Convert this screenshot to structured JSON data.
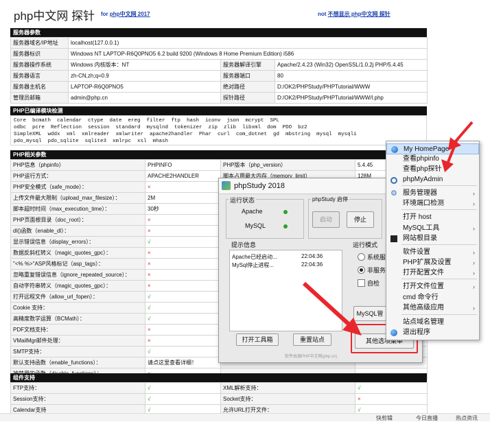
{
  "header": {
    "title": "php中文网 探针",
    "for_prefix": "for",
    "for_link": "php中文网 2017",
    "not_prefix": "not",
    "not_link": "不想显示 php中文网 探针"
  },
  "server": {
    "section_title": "服务器参数",
    "rows": [
      {
        "l1": "服务器域名/IP地址",
        "v1": "localhost(127.0.0.1)",
        "l2": "",
        "v2": ""
      },
      {
        "l1": "服务器标识",
        "v1": "Windows NT LAPTOP-R6Q0PNO5 6.2 build 9200 (Windows 8 Home Premium Edition) i586",
        "l2": "",
        "v2": ""
      },
      {
        "l1": "服务器操作系统",
        "v1": "Windows  内核版本：NT",
        "l2": "服务器解译引擎",
        "v2": "Apache/2.4.23 (Win32) OpenSSL/1.0.2j PHP/5.4.45"
      },
      {
        "l1": "服务器语言",
        "v1": "zh-CN,zh;q=0.9",
        "l2": "服务器端口",
        "v2": "80"
      },
      {
        "l1": "服务器主机名",
        "v1": "LAPTOP-R6Q0PNO5",
        "l2": "绝对路径",
        "v2": "D:/OK2/PHPStudy/PHPTutorial/WWW"
      },
      {
        "l1": "管理员邮箱",
        "v1": "admin@php.cn",
        "l2": "探针路径",
        "v2": "D:/OK2/PHPStudy/PHPTutorial/WWW/l.php"
      }
    ]
  },
  "modules": {
    "section_title": "PHP已编译模块检测",
    "lines": [
      "Core  bcmath  calendar  ctype  date  ereg  filter  ftp  hash  iconv  json  mcrypt  SPL",
      "odbc  pcre  Reflection  session  standard  mysqlnd  tokenizer  zip  zlib  libxml  dom  PDO  bz2",
      "SimpleXML  wddx  xml  xmlreader  xmlwriter  apache2handler  Phar  curl  com_dotnet  gd  mbstring  mysql  mysqli",
      "pdo_mysql  pdo_sqlite  sqlite3  xmlrpc  xsl  mhash"
    ]
  },
  "php": {
    "section_title": "PHP相关参数",
    "rows": [
      {
        "l1": "PHP信息（phpinfo）",
        "v1": "PHPINFO",
        "l2": "PHP版本（php_version）",
        "v2": "5.4.45"
      },
      {
        "l1": "PHP运行方式：",
        "v1": "APACHE2HANDLER",
        "l2": "脚本占用最大内存（memory_limit）",
        "v2": "128M"
      },
      {
        "l1": "PHP安全模式（safe_mode）：",
        "v1": "×",
        "l2": "",
        "v2": ""
      },
      {
        "l1": "上传文件最大限制（upload_max_filesize）：",
        "v1": "2M",
        "l2": "",
        "v2": ""
      },
      {
        "l1": "脚本超时时间（max_execution_time）：",
        "v1": "30秒",
        "l2": "",
        "v2": ""
      },
      {
        "l1": "PHP页面根目录（doc_root）：",
        "v1": "×",
        "l2": "",
        "v2": ""
      },
      {
        "l1": "dl()函数（enable_dl）：",
        "v1": "×",
        "l2": "",
        "v2": ""
      },
      {
        "l1": "显示错误信息（display_errors）：",
        "v1": "√",
        "l2": "",
        "v2": ""
      },
      {
        "l1": "数据反斜杠转义（magic_quotes_gpc）：",
        "v1": "×",
        "l2": "",
        "v2": ""
      },
      {
        "l1": "\"<% %>\"ASP风格标记（asp_tags）：",
        "v1": "×",
        "l2": "",
        "v2": ""
      },
      {
        "l1": "忽略重复错误信息（ignore_repeated_source）：",
        "v1": "×",
        "l2": "",
        "v2": ""
      },
      {
        "l1": "自动字符串转义（magic_quotes_gpc）：",
        "v1": "×",
        "l2": "",
        "v2": ""
      },
      {
        "l1": "打开远程文件（allow_url_fopen）：",
        "v1": "√",
        "l2": "",
        "v2": ""
      },
      {
        "l1": "Cookie 支持：",
        "v1": "√",
        "l2": "",
        "v2": ""
      },
      {
        "l1": "高精度数学运算（BCMath）：",
        "v1": "√",
        "l2": "",
        "v2": ""
      },
      {
        "l1": "PDF文档支持：",
        "v1": "×",
        "l2": "",
        "v2": ""
      },
      {
        "l1": "VMailMgr邮件处理：",
        "v1": "×",
        "l2": "",
        "v2": ""
      },
      {
        "l1": "SMTP支持：",
        "v1": "√",
        "l2": "",
        "v2": ""
      },
      {
        "l1": "默认支持函数（enable_functions）：",
        "v1": "请点这里查看详细！",
        "l2": "",
        "v2": ""
      },
      {
        "l1": "被禁用的函数（disable_functions）：",
        "v1": "×",
        "l2": "",
        "v2": ""
      }
    ]
  },
  "components": {
    "section_title": "组件支持",
    "rows": [
      {
        "l1": "FTP支持：",
        "v1": "√",
        "l2": "XML解析支持：",
        "v2": "√"
      },
      {
        "l1": "Session支持：",
        "v1": "√",
        "l2": "Socket支持：",
        "v2": "×"
      },
      {
        "l1": "Calendar支持",
        "v1": "√",
        "l2": "允许URL打开文件：",
        "v2": "√"
      }
    ]
  },
  "phpstudy": {
    "title": "phpStudy 2018",
    "run_status": "运行状态",
    "apache": "Apache",
    "mysql": "MySQL",
    "start_stop": "phpStudy  启停",
    "start_btn": "启动",
    "stop_btn": "停止",
    "info_label": "提示信息",
    "log": [
      {
        "msg": "Apache已经启动...",
        "time": "22:04:36"
      },
      {
        "msg": "MySql停止进程...",
        "time": "22:04:36"
      }
    ],
    "run_mode": "运行模式",
    "mode_system": "系统服",
    "mode_non": "非服务",
    "auto_check": "自检",
    "mysql_mgr": "MySQL管",
    "open_toolbox": "打开工具箱",
    "reset_site": "重置站点",
    "other_menu": "其他选项菜单",
    "watermark": "软件由源PHP中文网(php.cn)"
  },
  "menu": {
    "items": [
      {
        "label": "My HomePage",
        "arrow": false,
        "icon": "globe-icon"
      },
      {
        "label": "查看phpinfo",
        "arrow": false,
        "icon": ""
      },
      {
        "label": "查看php探针",
        "arrow": false,
        "icon": ""
      },
      {
        "label": "phpMyAdmin",
        "arrow": false,
        "icon": "link-icon"
      },
      {
        "label": "服务管理器",
        "arrow": true,
        "icon": "gear-icon"
      },
      {
        "label": "环境端口检测",
        "arrow": true,
        "icon": ""
      },
      {
        "label": "打开 host",
        "arrow": false,
        "icon": ""
      },
      {
        "label": "MySQL工具",
        "arrow": true,
        "icon": ""
      },
      {
        "label": "网站根目录",
        "arrow": false,
        "icon": "terminal-icon"
      },
      {
        "label": "软件设置",
        "arrow": true,
        "icon": ""
      },
      {
        "label": "PHP扩展及设置",
        "arrow": true,
        "icon": ""
      },
      {
        "label": "打开配置文件",
        "arrow": true,
        "icon": ""
      },
      {
        "label": "打开文件位置",
        "arrow": true,
        "icon": ""
      },
      {
        "label": "cmd 命令行",
        "arrow": false,
        "icon": ""
      },
      {
        "label": "其他高级应用",
        "arrow": true,
        "icon": ""
      },
      {
        "label": "站点域名管理",
        "arrow": false,
        "icon": ""
      },
      {
        "label": "退出程序",
        "arrow": false,
        "icon": "exit-icon"
      }
    ]
  },
  "statusbar": {
    "a": "快剪辑",
    "b": "今日直播",
    "c": "热点资讯"
  },
  "colors": {
    "accent": "#1a3fb0",
    "ok": "#2b9a2b",
    "error": "#e03030",
    "arrow": "#e8272d"
  }
}
